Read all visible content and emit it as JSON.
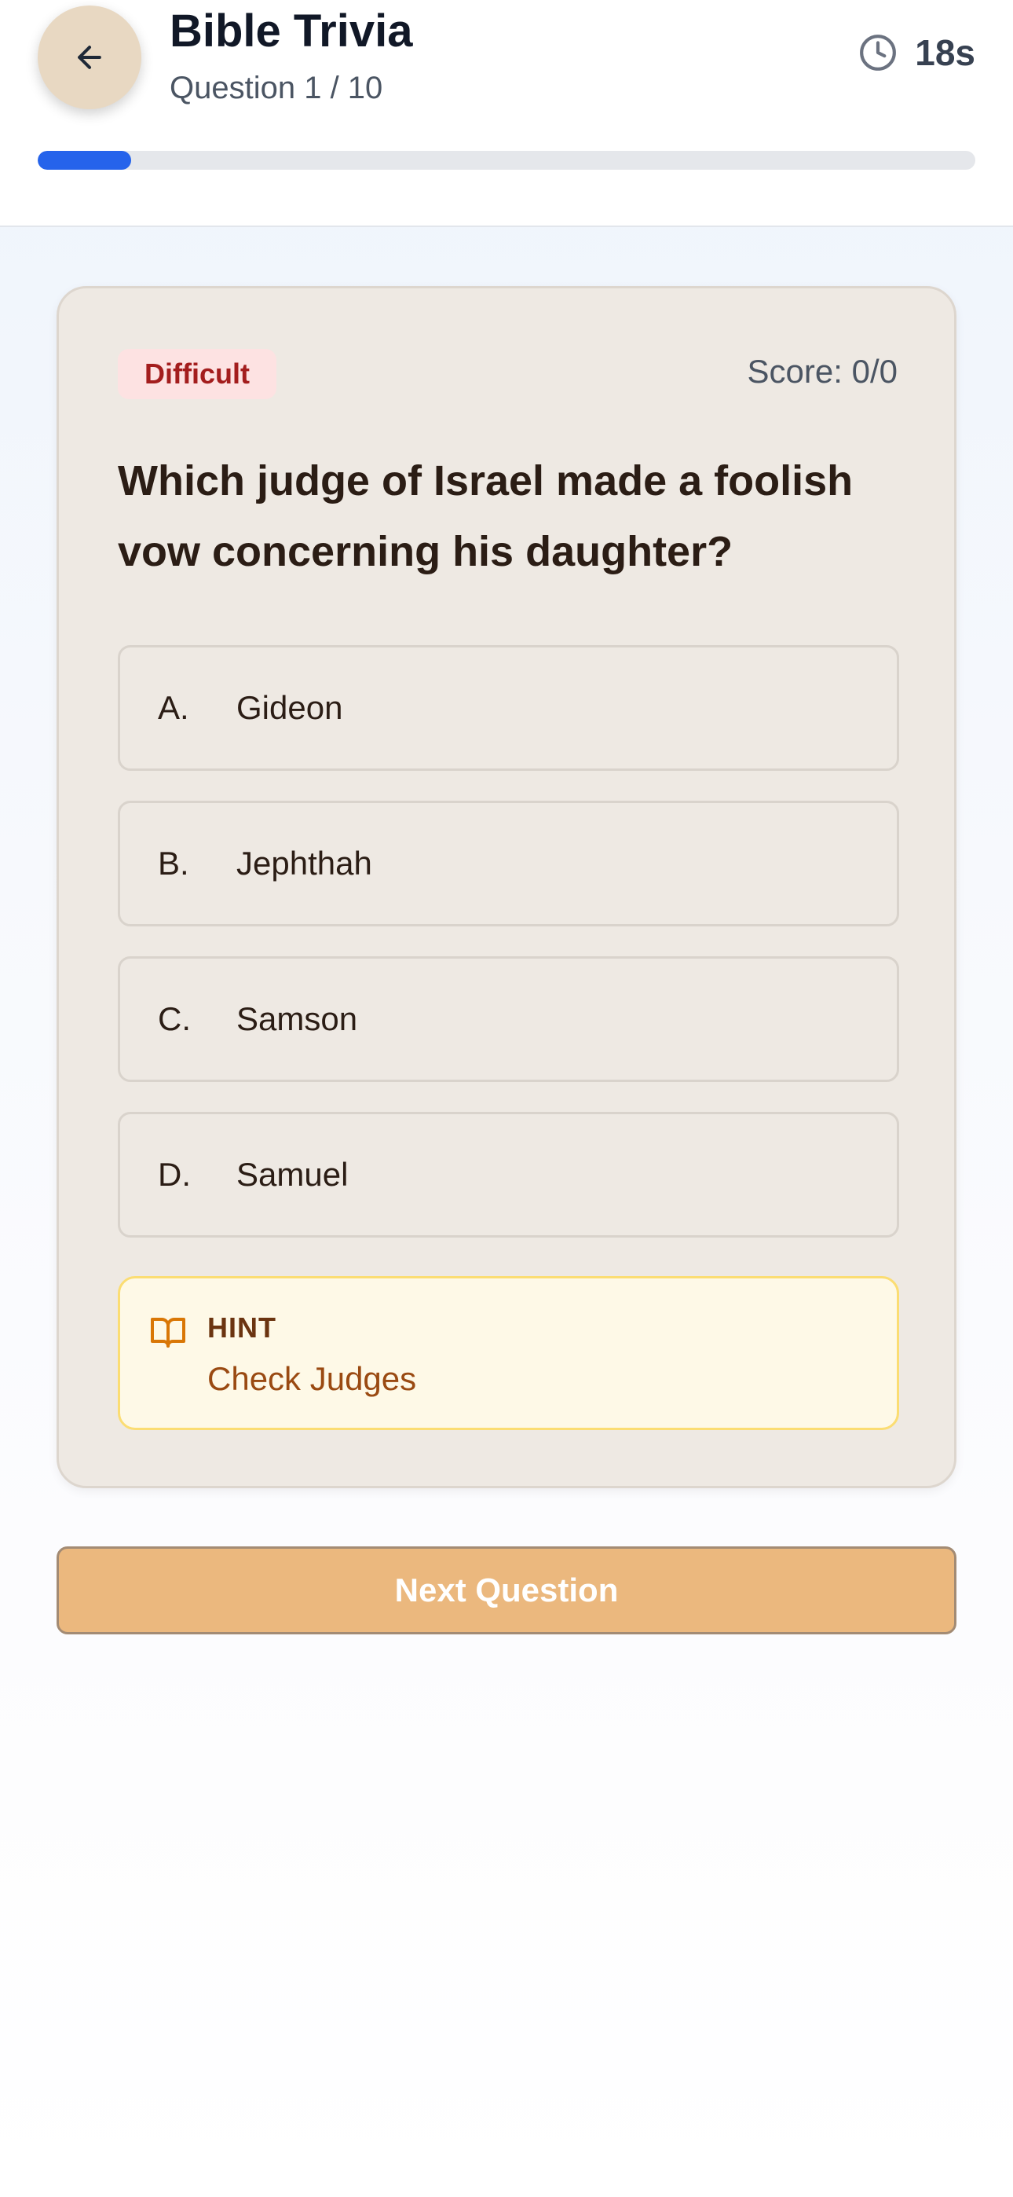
{
  "header": {
    "title": "Bible Trivia",
    "subtitle": "Question 1 / 10",
    "timer": "18s",
    "progress_percent": 10
  },
  "card": {
    "difficulty": "Difficult",
    "score": "Score: 0/0",
    "question": "Which judge of Israel made a foolish vow concerning his daughter?",
    "options": [
      {
        "letter": "A.",
        "text": "Gideon"
      },
      {
        "letter": "B.",
        "text": "Jephthah"
      },
      {
        "letter": "C.",
        "text": "Samson"
      },
      {
        "letter": "D.",
        "text": "Samuel"
      }
    ],
    "hint": {
      "label": "HINT",
      "text": "Check Judges",
      "icon": "book-open-icon"
    }
  },
  "footer": {
    "next_label": "Next Question"
  },
  "colors": {
    "accent": "#2563eb",
    "badge_bg": "#fde2e2",
    "badge_text": "#a31d1d",
    "next_button": "#ebb87e",
    "hint_bg": "#fef9e7"
  }
}
